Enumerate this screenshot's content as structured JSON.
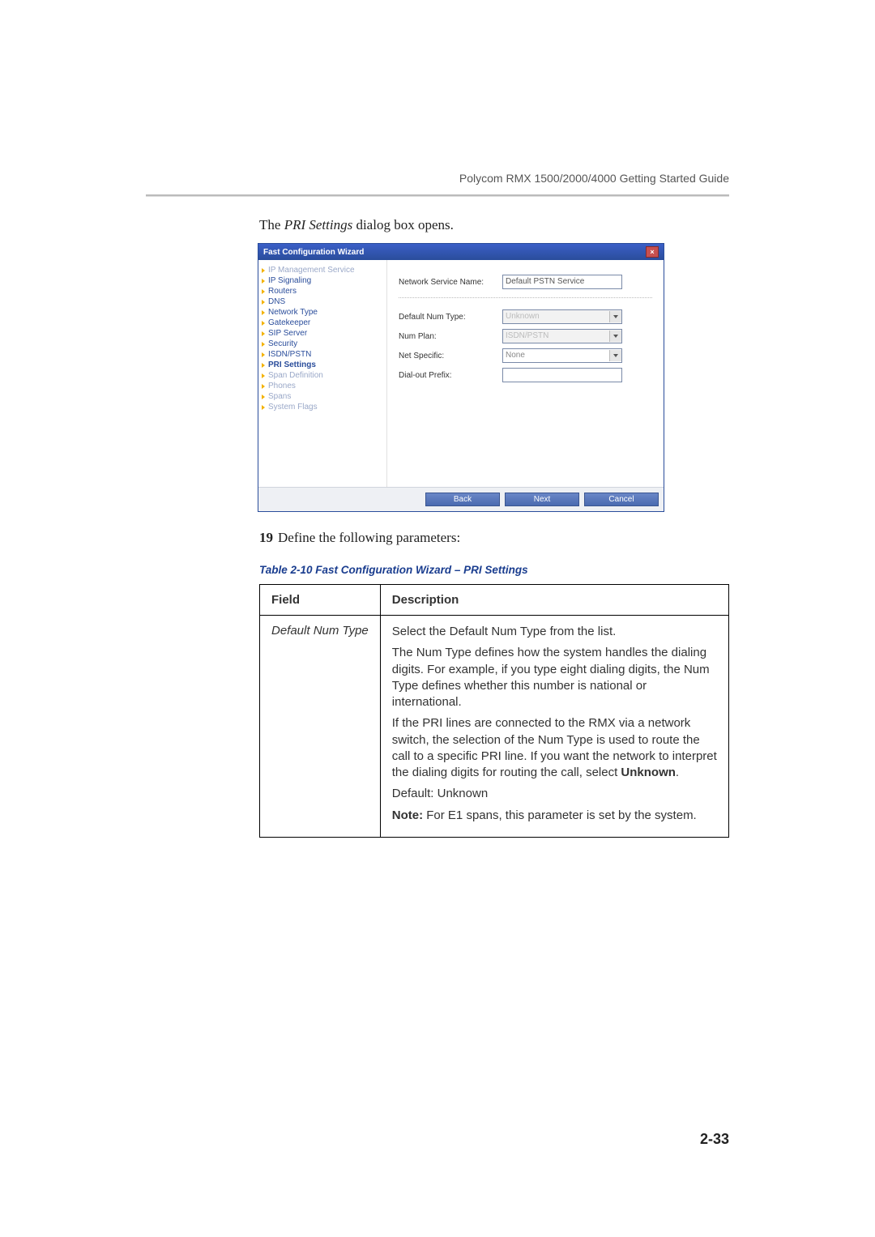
{
  "header": {
    "running": "Polycom RMX 1500/2000/4000 Getting Started Guide"
  },
  "intro": {
    "prefix": "The ",
    "italic": "PRI Settings",
    "suffix": " dialog box opens."
  },
  "dialog": {
    "title": "Fast Configuration Wizard",
    "nav": [
      {
        "label": "IP Management Service",
        "dim": true
      },
      {
        "label": "IP Signaling"
      },
      {
        "label": "Routers"
      },
      {
        "label": "DNS"
      },
      {
        "label": "Network Type"
      },
      {
        "label": "Gatekeeper"
      },
      {
        "label": "SIP Server"
      },
      {
        "label": "Security"
      },
      {
        "label": "ISDN/PSTN"
      },
      {
        "label": "PRI Settings",
        "bold": true
      },
      {
        "label": "Span Definition",
        "dim": true
      },
      {
        "label": "Phones",
        "dim": true
      },
      {
        "label": "Spans",
        "dim": true
      },
      {
        "label": "System Flags",
        "dim": true
      }
    ],
    "fields": {
      "service_label": "Network Service Name:",
      "service_value": "Default PSTN Service",
      "defnum_label": "Default Num Type:",
      "defnum_value": "Unknown",
      "numplan_label": "Num Plan:",
      "numplan_value": "ISDN/PSTN",
      "netspec_label": "Net Specific:",
      "netspec_value": "None",
      "dialout_label": "Dial-out Prefix:",
      "dialout_value": ""
    },
    "buttons": {
      "back": "Back",
      "next": "Next",
      "cancel": "Cancel"
    }
  },
  "step": {
    "num": "19",
    "text": "Define the following parameters:"
  },
  "table": {
    "caption_prefix": "Table 2-10",
    "caption_rest": "  Fast Configuration Wizard – PRI Settings",
    "head_field": "Field",
    "head_desc": "Description",
    "rows": [
      {
        "field": "Default Num Type",
        "p1": "Select the Default Num Type from the list.",
        "p2": "The Num Type defines how the system handles the dialing digits. For example, if you type eight dialing digits, the Num Type defines whether this number is national or international.",
        "p3a": "If the PRI lines are connected to the RMX via a network switch, the selection of the Num Type is used to route the call to a specific PRI line. If you want the network to interpret the dialing digits for routing the call, select ",
        "p3b": "Unknown",
        "p3c": ".",
        "p4": "Default: Unknown",
        "p5a": "Note:",
        "p5b": " For E1 spans, this parameter is set by the system."
      }
    ]
  },
  "page_number": "2-33"
}
